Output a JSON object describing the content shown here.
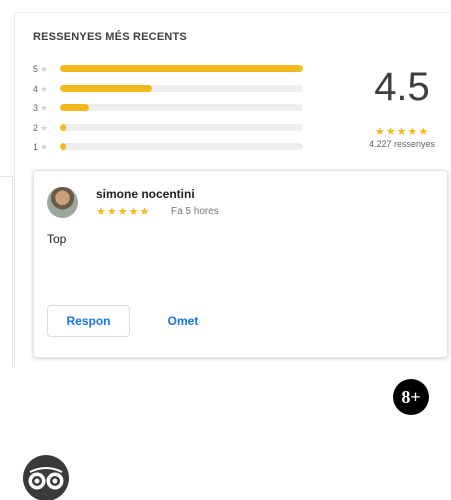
{
  "summary": {
    "title": "RESSENYES MÉS RECENTS",
    "average": "4.5",
    "average_stars": "★★★★★",
    "count": "4.227 ressenyes",
    "distribution": [
      {
        "stars": "5",
        "fraction": 1.0
      },
      {
        "stars": "4",
        "fraction": 0.38
      },
      {
        "stars": "3",
        "fraction": 0.12
      },
      {
        "stars": "2",
        "fraction": 0.02
      },
      {
        "stars": "1",
        "fraction": 0.02
      }
    ]
  },
  "review": {
    "author": "simone nocentini",
    "stars": "★★★★★",
    "time": "Fa 5 hores",
    "text": "Top",
    "reply_label": "Respon",
    "omit_label": "Omet"
  },
  "badges": {
    "gplus_label": "8+"
  },
  "colors": {
    "star": "#f2b91d",
    "accent": "#1a73e8"
  }
}
